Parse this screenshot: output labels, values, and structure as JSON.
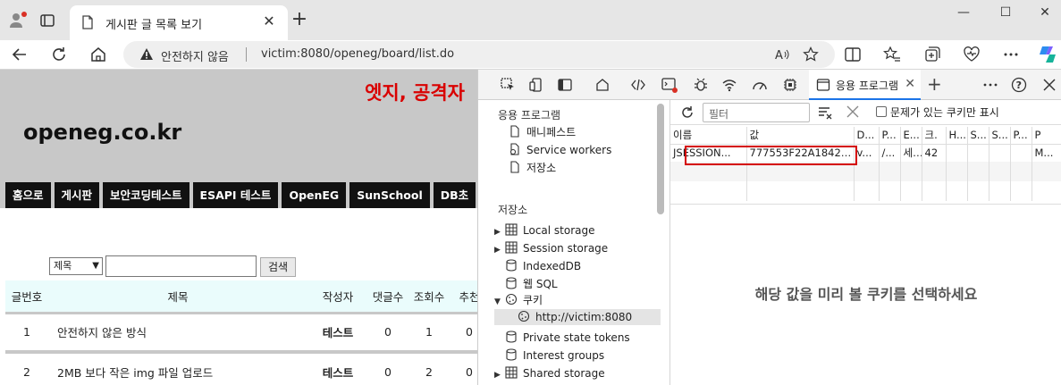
{
  "browser": {
    "tab_title": "게시판 글 목록 보기",
    "tab_close": "✕",
    "new_tab": "+",
    "window_controls": [
      "—",
      "☐",
      "✕"
    ],
    "security_warning": "안전하지 않음",
    "url": "victim:8080/openeg/board/list.do",
    "accent_color": "#1a73e8"
  },
  "page": {
    "annotation": "엣지, 공격자",
    "annotation_color": "#d90000",
    "site_title": "openeg.co.kr",
    "nav": [
      "홈으로",
      "게시판",
      "보안코딩테스트",
      "ESAPI 테스트",
      "OpenEG",
      "SunSchool",
      "DB초"
    ],
    "search": {
      "select_value": "제목",
      "input_value": "",
      "button_label": "검색"
    },
    "table": {
      "headers": [
        "글번호",
        "제목",
        "작성자",
        "댓글수",
        "조회수",
        "추천"
      ],
      "rows": [
        [
          "1",
          "안전하지 않은 방식",
          "테스트",
          "0",
          "1",
          "0"
        ],
        [
          "2",
          "2MB 보다 작은 img 파일 업로드",
          "테스트",
          "0",
          "2",
          "0"
        ]
      ]
    }
  },
  "devtools": {
    "active_tab": "응용 프로그램",
    "tab_close": "✕",
    "add_tab": "+",
    "toolbar_icons": [
      "inspect-icon",
      "device-icon",
      "dock-icon",
      "home-icon",
      "elements-icon",
      "console-icon",
      "sources-icon",
      "network-icon",
      "performance-icon",
      "memory-icon"
    ],
    "sidebar": {
      "app_header": "응용 프로그램",
      "app_items": [
        "매니페스트",
        "Service workers",
        "저장소"
      ],
      "storage_header": "저장소",
      "storage_items": [
        "Local storage",
        "Session storage",
        "IndexedDB",
        "웹 SQL",
        "쿠키"
      ],
      "cookie_origin": "http://victim:8080",
      "other_items": [
        "Private state tokens",
        "Interest groups",
        "Shared storage"
      ]
    },
    "cookies": {
      "filter_placeholder": "필터",
      "issues_only_label": "문제가 있는 쿠키만 표시",
      "columns": [
        "이름",
        "값",
        "D...",
        "P...",
        "E...",
        "크.",
        "H...",
        "S...",
        "S...",
        "P...",
        "P"
      ],
      "rows": [
        [
          "JSESSION...",
          "777553F22A18426...",
          "v...",
          "/...",
          "세...",
          "42",
          "",
          "",
          "",
          "",
          "M..."
        ]
      ],
      "preview_message": "해당 값을 미리 볼 쿠키를 선택하세요",
      "highlight_color": "#d40000"
    }
  }
}
